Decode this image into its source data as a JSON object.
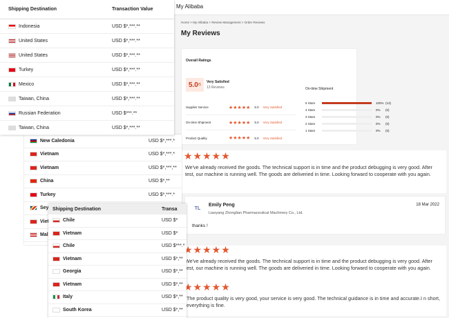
{
  "panelA": {
    "col1": "Shipping Destination",
    "col2": "Transaction Value",
    "rows": [
      {
        "country": "Indonesia",
        "value": "USD $*,***.**",
        "flag": "id"
      },
      {
        "country": "United States",
        "value": "USD $*,***.**",
        "flag": "us"
      },
      {
        "country": "United States",
        "value": "USD $*,***.**",
        "flag": "us"
      },
      {
        "country": "Turkey",
        "value": "USD $*,***.**",
        "flag": "tr"
      },
      {
        "country": "Mexico",
        "value": "USD $*,***.**",
        "flag": "mx"
      },
      {
        "country": "Taiwan, China",
        "value": "USD $*,***.**",
        "flag": "tw"
      },
      {
        "country": "Russian Federation",
        "value": "USD $***.**",
        "flag": "ru"
      },
      {
        "country": "Taiwan, China",
        "value": "USD $*,***.**",
        "flag": "tw"
      }
    ]
  },
  "panelB": {
    "rows": [
      {
        "country": "New Caledonia",
        "value": "USD $*,***.*",
        "flag": "nc"
      },
      {
        "country": "Vietnam",
        "value": "USD $*,***.*",
        "flag": "vn"
      },
      {
        "country": "Vietnam",
        "value": "USD $*,***,**",
        "flag": "vn"
      },
      {
        "country": "China",
        "value": "USD $*,**",
        "flag": "cn"
      },
      {
        "country": "Turkey",
        "value": "USD $*,***.*",
        "flag": "tr"
      },
      {
        "country": "Sey",
        "value": "",
        "flag": "sc"
      },
      {
        "country": "Viet",
        "value": "",
        "flag": "vn"
      },
      {
        "country": "Mal",
        "value": "",
        "flag": "my"
      }
    ]
  },
  "panelC": {
    "col1": "Shipping Destination",
    "col2": "Transa",
    "rows": [
      {
        "country": "Chile",
        "value": "USD $*",
        "flag": "cl"
      },
      {
        "country": "Vietnam",
        "value": "USD $*",
        "flag": "vn"
      },
      {
        "country": "Chile",
        "value": "USD $***.*",
        "flag": "cl"
      },
      {
        "country": "Vietnam",
        "value": "USD $*,**",
        "flag": "vn"
      },
      {
        "country": "Georgia",
        "value": "USD $*,**",
        "flag": "ge"
      },
      {
        "country": "Vietnam",
        "value": "USD $*,**",
        "flag": "vn"
      },
      {
        "country": "Italy",
        "value": "USD $*,**",
        "flag": "it"
      },
      {
        "country": "South Korea",
        "value": "USD $*,**",
        "flag": "kr"
      }
    ]
  },
  "brand": "My Alibaba",
  "breadcrumb": [
    "Home",
    "My Alibaba",
    "Review Management",
    "Order Reviews"
  ],
  "page_title": "My Reviews",
  "overall": {
    "heading": "Overall Ratings",
    "score": "5.0",
    "score_suffix": "/5",
    "label": "Very Satisfied",
    "count": "13 Reviews",
    "criteria": [
      {
        "name": "Supplier Service",
        "score": "5.0",
        "label": "Very Satisfied"
      },
      {
        "name": "On-time Shipment",
        "score": "5.0",
        "label": "Very Satisfied"
      },
      {
        "name": "Product Quality",
        "score": "5.0",
        "label": "Very Satisfied"
      }
    ],
    "shipment_title": "On-time Shipment",
    "dist": [
      {
        "label": "5 Stars",
        "pct": "100%",
        "count": "(13)",
        "fill": 1
      },
      {
        "label": "4 Stars",
        "pct": "0%",
        "count": "(0)",
        "fill": 0
      },
      {
        "label": "3 Stars",
        "pct": "0%",
        "count": "(0)",
        "fill": 0
      },
      {
        "label": "2 Stars",
        "pct": "0%",
        "count": "(0)",
        "fill": 0
      },
      {
        "label": "1 Stars",
        "pct": "0%",
        "count": "(0)",
        "fill": 0
      }
    ]
  },
  "review1": {
    "stars": "★★★★★",
    "text": "We've already received the goods. The technical support is in time and the product debugging is very good. After test, our machine is running well. The goods are deliveried in time. Looking forward to cooperate with you again."
  },
  "reply": {
    "initials": "TL",
    "name": "Emily Peng",
    "date": "18 Mar 2022",
    "company": "Liaoyang Zhonglian Pharmaceutical Machinery Co., Ltd.",
    "text": "thanks !"
  },
  "review2": {
    "stars": "★★★★★",
    "text": "We've already received the goods. The technical support is in time and the product debugging is very good. After test, our machine is running well. The goods are deliveried in time. Looking forward to cooperate with you again."
  },
  "review3": {
    "stars": "★★★★★",
    "text": "The product quality is very good, your service is very good. The technical guidance is in time and accurate.I n short, everything is fine."
  },
  "colors": {
    "accent": "#e4572e",
    "bar": "#c43a1d",
    "score_bg": "#fde9e2"
  }
}
